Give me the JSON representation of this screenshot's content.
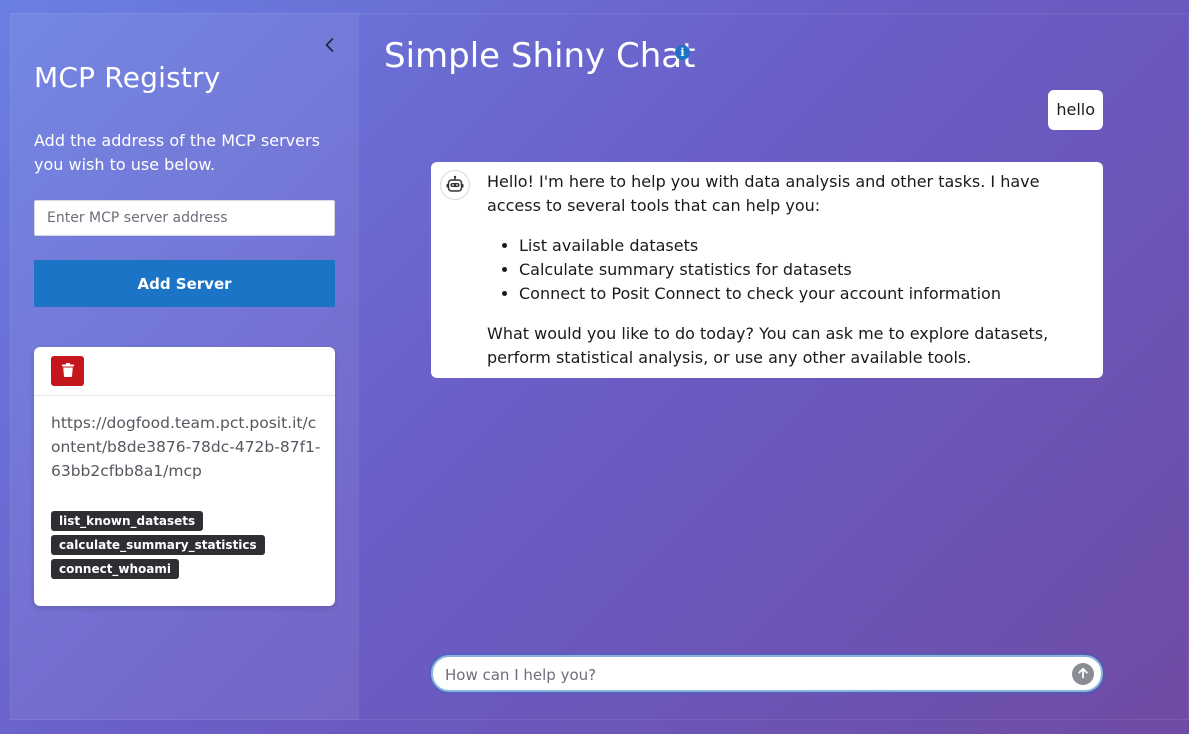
{
  "sidebar": {
    "title": "MCP Registry",
    "description": "Add the address of the MCP servers you wish to use below.",
    "server_input_placeholder": "Enter MCP server address",
    "add_server_label": "Add Server",
    "collapse_icon": "chevron-left-icon",
    "servers": [
      {
        "url": "https://dogfood.team.pct.posit.it/content/b8de3876-78dc-472b-87f1-63bb2cfbb8a1/mcp",
        "delete_icon": "trash-icon",
        "tools": [
          "list_known_datasets",
          "calculate_summary_statistics",
          "connect_whoami"
        ]
      }
    ]
  },
  "chat": {
    "title": "Simple Shiny Chat",
    "info_icon": "info-icon",
    "messages": [
      {
        "role": "user",
        "text": "hello"
      },
      {
        "role": "assistant",
        "avatar_icon": "robot-icon",
        "intro": "Hello! I'm here to help you with data analysis and other tasks. I have access to several tools that can help you:",
        "bullets": [
          "List available datasets",
          "Calculate summary statistics for datasets",
          "Connect to Posit Connect to check your account information"
        ],
        "outro": "What would you like to do today? You can ask me to explore datasets, perform statistical analysis, or use any other available tools."
      }
    ],
    "input_placeholder": "How can I help you?",
    "send_icon": "arrow-up-icon"
  },
  "colors": {
    "primary": "#1b74c5",
    "danger": "#c4161c",
    "badge": "#2d2f33"
  }
}
